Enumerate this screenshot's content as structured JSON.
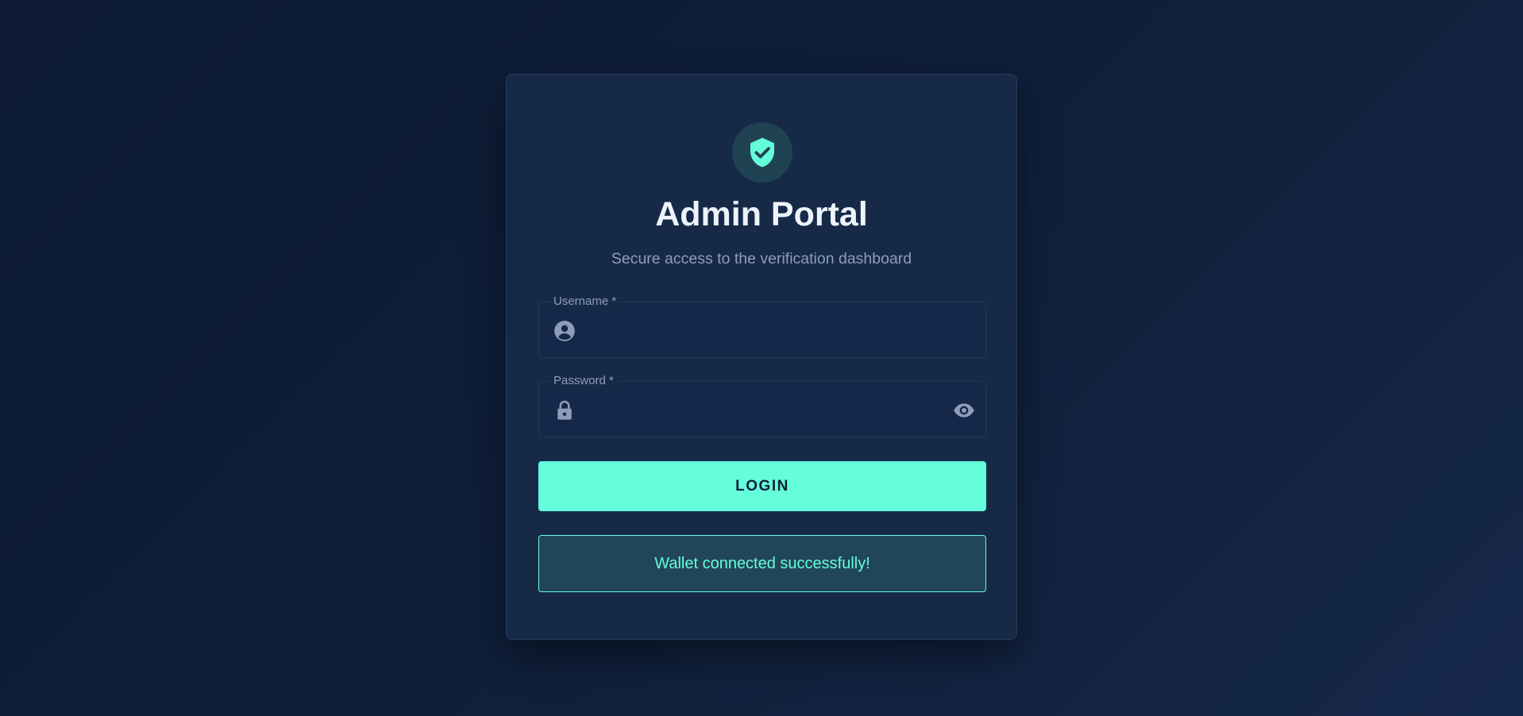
{
  "header": {
    "logo_icon": "shield-check-icon",
    "title": "Admin Portal",
    "subtitle": "Secure access to the verification dashboard"
  },
  "form": {
    "username": {
      "label": "Username *",
      "value": "",
      "icon": "user-circle-icon"
    },
    "password": {
      "label": "Password *",
      "value": "",
      "icon": "lock-icon",
      "toggle_icon": "eye-icon"
    },
    "login_label": "LOGIN"
  },
  "status": {
    "message": "Wallet connected successfully!"
  },
  "colors": {
    "accent": "#64ffda",
    "background": "#0f1f3a",
    "card": "#162a48",
    "muted_text": "#8c9dba"
  }
}
